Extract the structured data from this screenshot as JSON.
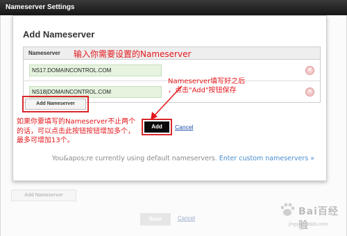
{
  "window": {
    "title": "Nameserver Settings"
  },
  "modal": {
    "title": "Add Nameserver",
    "table_header": "Nameserver",
    "rows": [
      {
        "value": "NS17.DOMAINCONTROL.COM"
      },
      {
        "value": "NS18|DOMAINCONTROL.COM"
      }
    ],
    "remove_glyph": "×",
    "add_nameserver_label": "Add Nameserver",
    "add_label": "Add",
    "cancel_label": "Cancel",
    "default_message": "You&apos;re currently using default nameservers.",
    "custom_link": "Enter custom nameservers »"
  },
  "annotations": {
    "top": "输入你需要设置的Nameserver",
    "right_line1": "Nameserver填写好之后",
    "right_line2": "，点击\"Add\"按钮保存",
    "left": "如果你要填写的Nameserver不止两个的话，可以点击此按钮按钮增加多个，最多可增加13个。",
    "color": "#e3171c"
  },
  "background": {
    "add_nameserver_label": "Add Nameserver",
    "save_label": "Save",
    "cancel_label": "Cancel"
  },
  "watermark": {
    "logo_text": "Bai百经验",
    "url": "jingyan.baidu.com"
  },
  "icons": {
    "remove": "remove-circle-icon",
    "arrow": "red-arrow-icon",
    "paw": "baidu-paw-icon"
  }
}
